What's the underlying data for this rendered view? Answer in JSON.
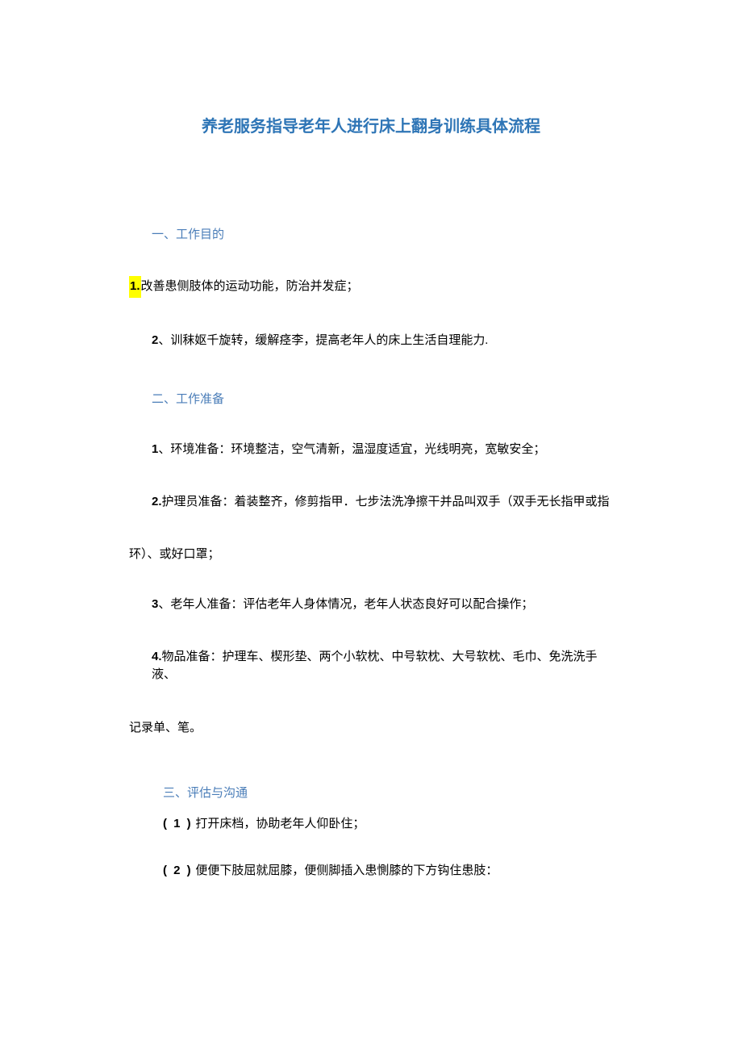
{
  "title": "养老服务指导老年人进行床上翻身训练具体流程",
  "sections": {
    "s1": {
      "heading": "一、工作目的",
      "items": {
        "i1_num": "1.",
        "i1_text": "改善患侧肢体的运动功能，防治并发症；",
        "i2_num": "2",
        "i2_text": "、训秣妪千旋转，缓解痉李，提高老年人的床上生活自理能力."
      }
    },
    "s2": {
      "heading": "二、工作准备",
      "items": {
        "i1_num": "1",
        "i1_text": "、环境准备：环境整洁，空气清新，温湿度适宜，光线明亮，宽敏安全；",
        "i2_num": "2.",
        "i2_text": "护理员准备：着装整齐，修剪指甲．七步法洗净擦干并品叫双手（双手无长指甲或指",
        "i2_wrap": "环）、或好口罩；",
        "i3_num": "3",
        "i3_text": "、老年人准备：评估老年人身体情况，老年人状态良好可以配合操作；",
        "i4_num": "4.",
        "i4_text": "物品准备：护理车、楔形垫、两个小软枕、中号软枕、大号软枕、毛巾、免洗洗手液、",
        "i4_wrap": "记录单、笔。"
      }
    },
    "s3": {
      "heading": "三、评估与沟通",
      "items": {
        "i1_num": "( 1 )",
        "i1_text": " 打开床档，协助老年人仰卧住；",
        "i2_num": "( 2 )",
        "i2_text": " 便便下肢屈就屈膝，便侧脚插入患惻膝的下方钩住患肢："
      }
    }
  }
}
